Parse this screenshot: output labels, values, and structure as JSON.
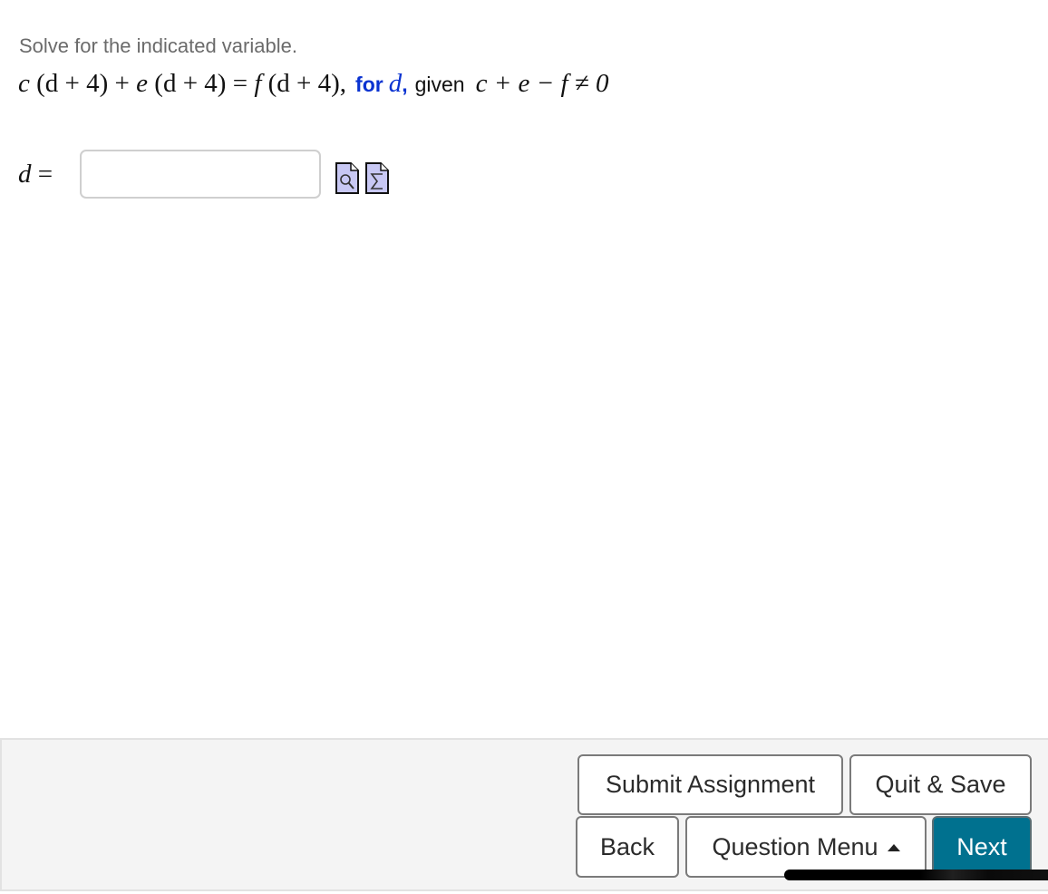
{
  "question": {
    "instruction": "Solve for the indicated variable.",
    "equation": {
      "lhs_term1_coef": "c",
      "lhs_term1_group": "(d + 4)",
      "plus": "+",
      "lhs_term2_coef": "e",
      "lhs_term2_group": "(d + 4)",
      "equals": "=",
      "rhs_coef": "f",
      "rhs_group": "(d + 4)",
      "trailing_comma": ","
    },
    "for_label": "for",
    "target_variable": "d",
    "for_comma": ",",
    "given_label": "given",
    "condition": "c + e − f ≠ 0"
  },
  "answer": {
    "label_var": "d",
    "label_equals": "=",
    "value": "",
    "placeholder": ""
  },
  "tools": {
    "preview_icon": "preview-magnifier-icon",
    "equation_editor_icon": "sigma-equation-editor-icon"
  },
  "footer": {
    "submit_label": "Submit Assignment",
    "quit_label": "Quit & Save",
    "back_label": "Back",
    "menu_label": "Question Menu",
    "menu_icon": "caret-up-icon",
    "next_label": "Next"
  },
  "colors": {
    "accent_blue": "#0a33d1",
    "next_button": "#00718f",
    "instruction_gray": "#6b6b6b",
    "icon_fill": "#c8c8f4"
  }
}
